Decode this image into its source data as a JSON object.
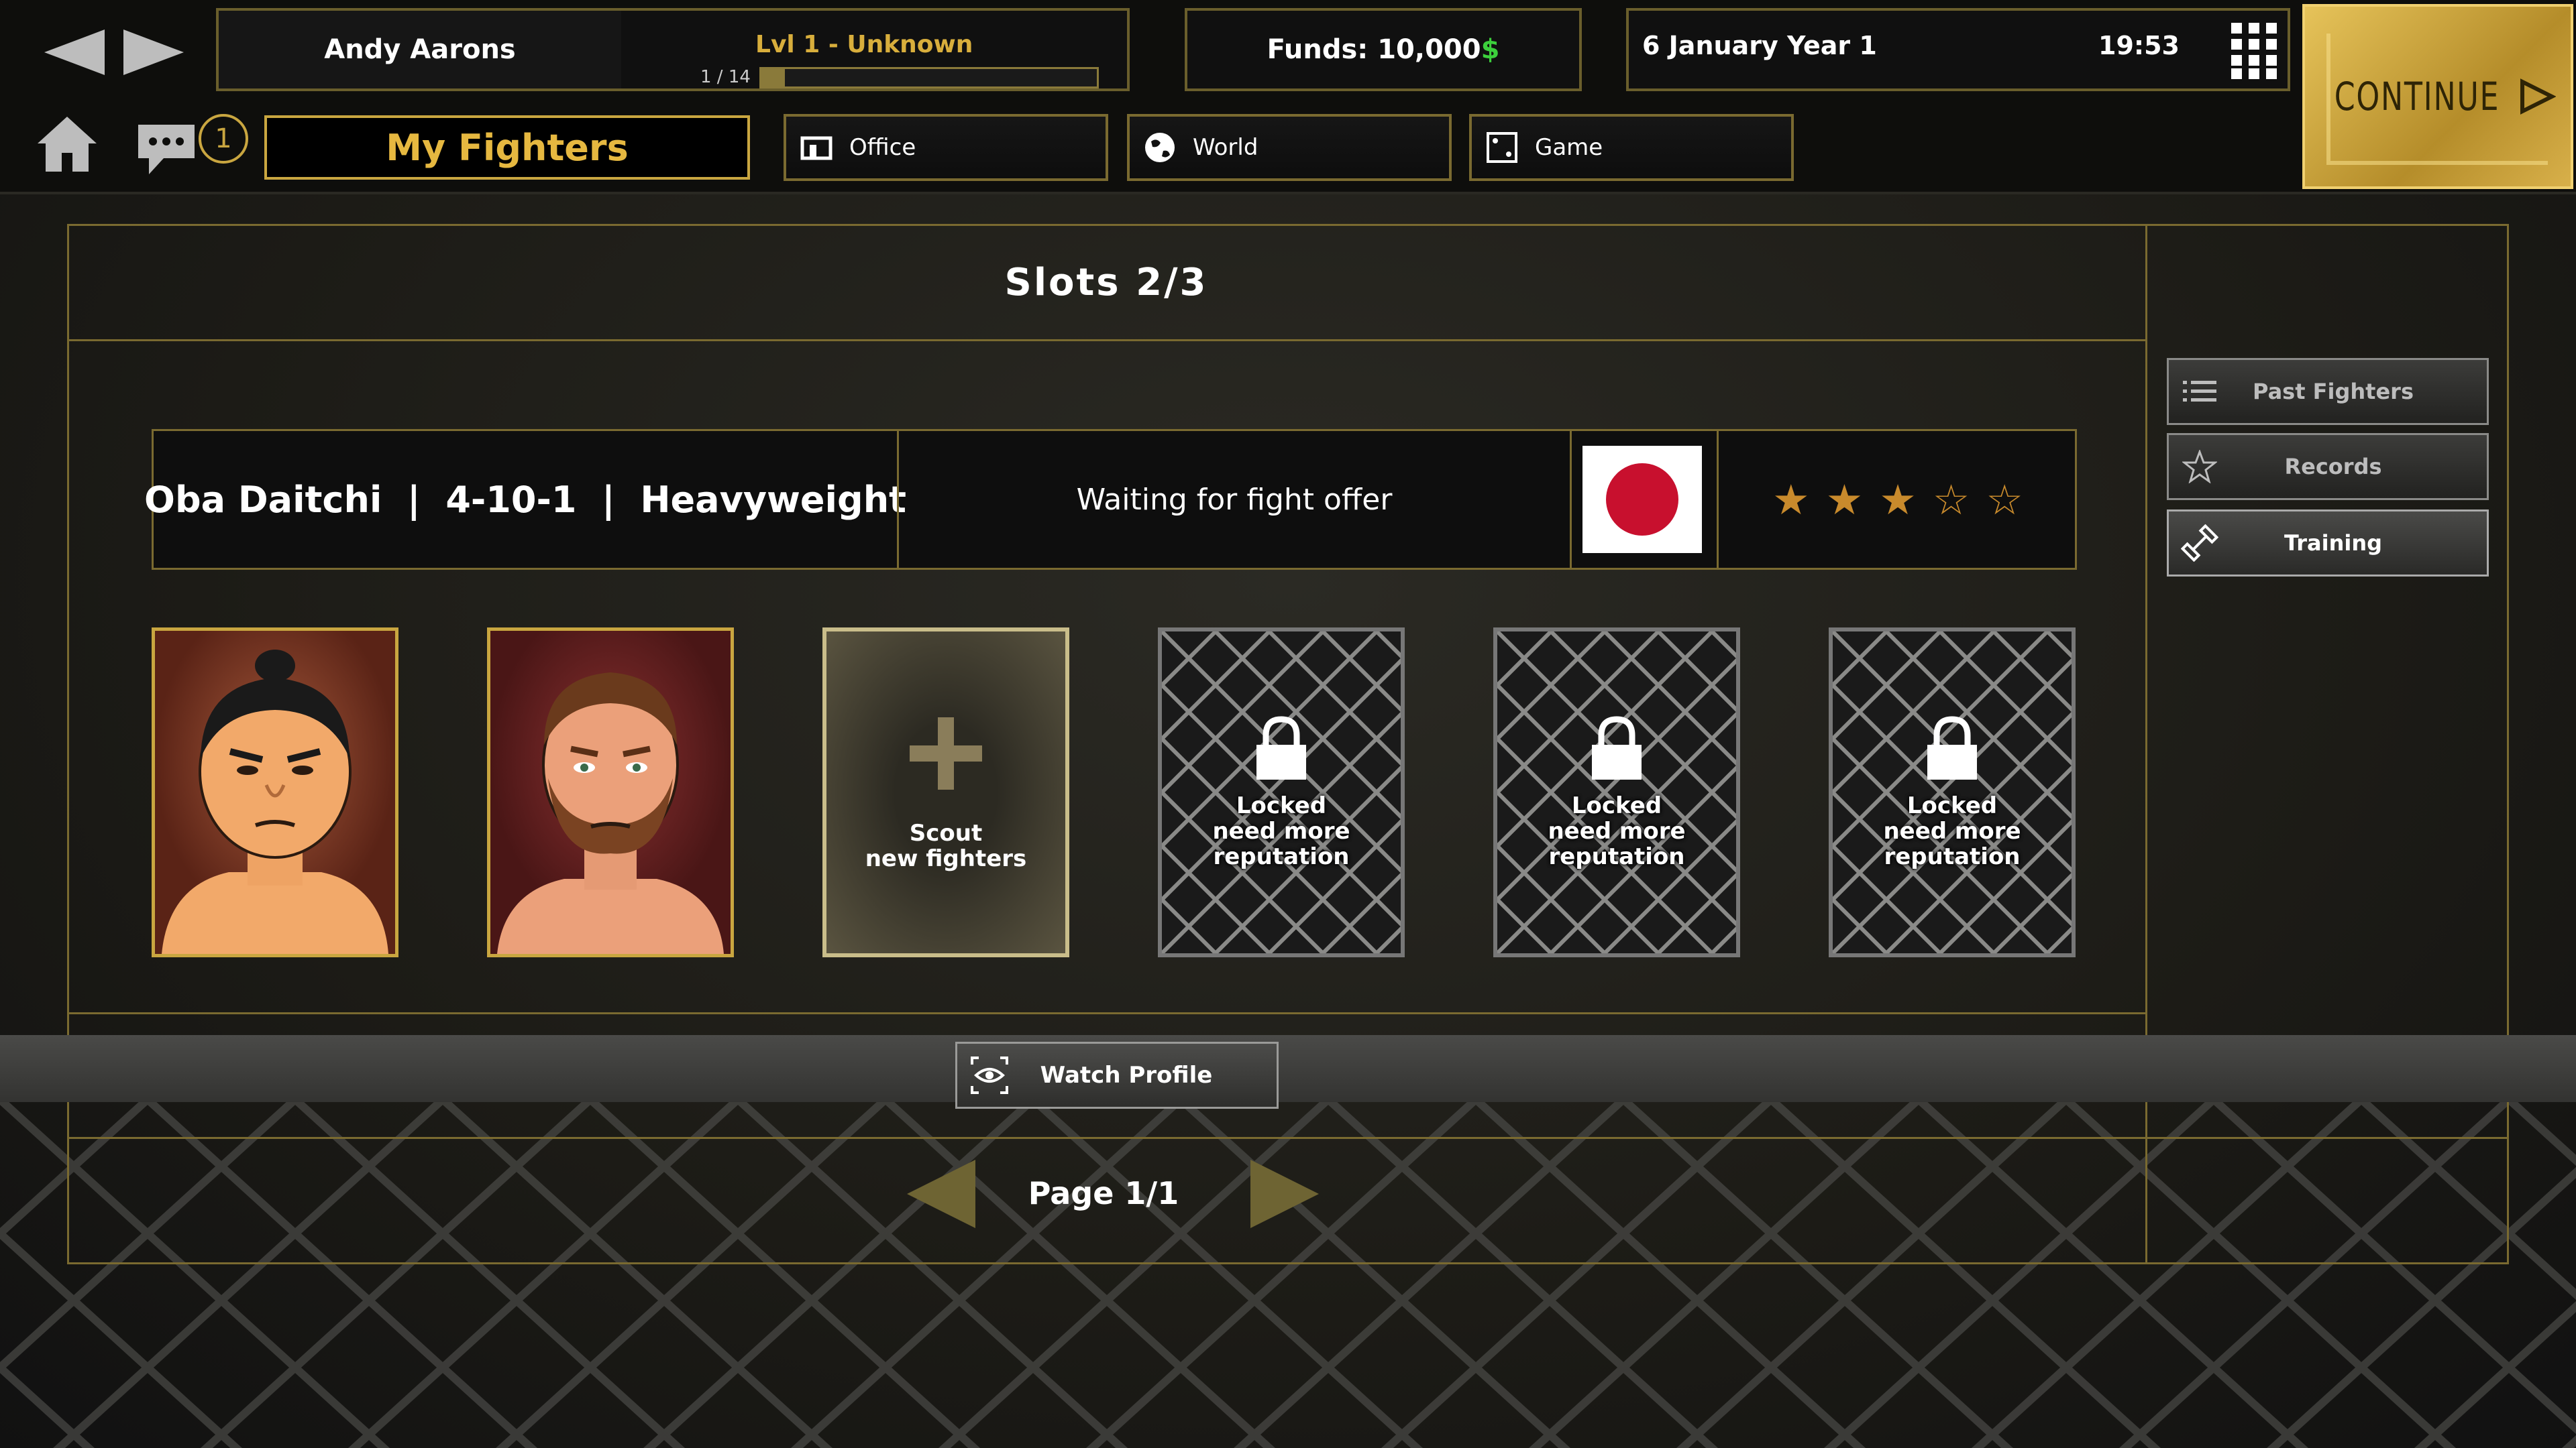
{
  "manager": {
    "name": "Andy Aarons",
    "level": "Lvl 1 - Unknown",
    "xp": "1 / 14",
    "xp_fraction": 0.07
  },
  "funds": {
    "label": "Funds: 10,000",
    "currency": "$"
  },
  "date": {
    "day": "6 January Year 1",
    "time": "19:53"
  },
  "continue_label": "CONTINUE",
  "notifications": {
    "count": "1"
  },
  "nav": {
    "current": "My Fighters",
    "office": "Office",
    "world": "World",
    "game": "Game"
  },
  "slots": {
    "label": "Slots 2/3"
  },
  "fighter": {
    "summary": "Oba Daitchi  |  4-10-1  |  Heavyweight",
    "status": "Waiting for fight offer",
    "country_flag": "japan",
    "rating": 3,
    "rating_max": 5
  },
  "cards": {
    "scout": {
      "line1": "Scout",
      "line2": "new fighters"
    },
    "locked": {
      "line1": "Locked",
      "line2": "need more",
      "line3": "reputation"
    }
  },
  "side": {
    "past_fighters": "Past Fighters",
    "records": "Records",
    "training": "Training"
  },
  "watch_profile": "Watch Profile",
  "pagination": {
    "label": "Page 1/1"
  },
  "colors": {
    "gold": "#d8ae3c",
    "border": "#7a6a30",
    "funds_symbol": "#3ccf3c",
    "star": "#c88a2c",
    "flag_red": "#c8102e"
  }
}
